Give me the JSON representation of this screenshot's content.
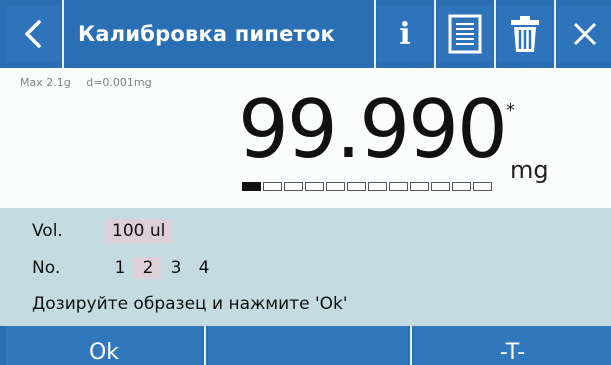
{
  "header": {
    "title": "Калибровка пипеток",
    "info_label": "i"
  },
  "spec": {
    "max": "Max 2.1g",
    "d": "d=0.001mg"
  },
  "reading": {
    "value": "99.990",
    "stability": "*",
    "unit": "mg",
    "bargraph_fill_fraction": 0.083
  },
  "panel": {
    "vol_label": "Vol.",
    "vol_value": "100 ul",
    "no_label": "No.",
    "numbers": [
      "1",
      "2",
      "3",
      "4"
    ],
    "active_number": "2",
    "instruction": "Дозируйте образец и нажмите 'Ok'"
  },
  "footer": {
    "ok_label": "Ok",
    "middle_label": "",
    "tare_label": "-T-"
  },
  "colors": {
    "header_blue": "#2a6fb4",
    "panel_bg": "#c5dbe2",
    "highlight": "#ddcfd8"
  }
}
